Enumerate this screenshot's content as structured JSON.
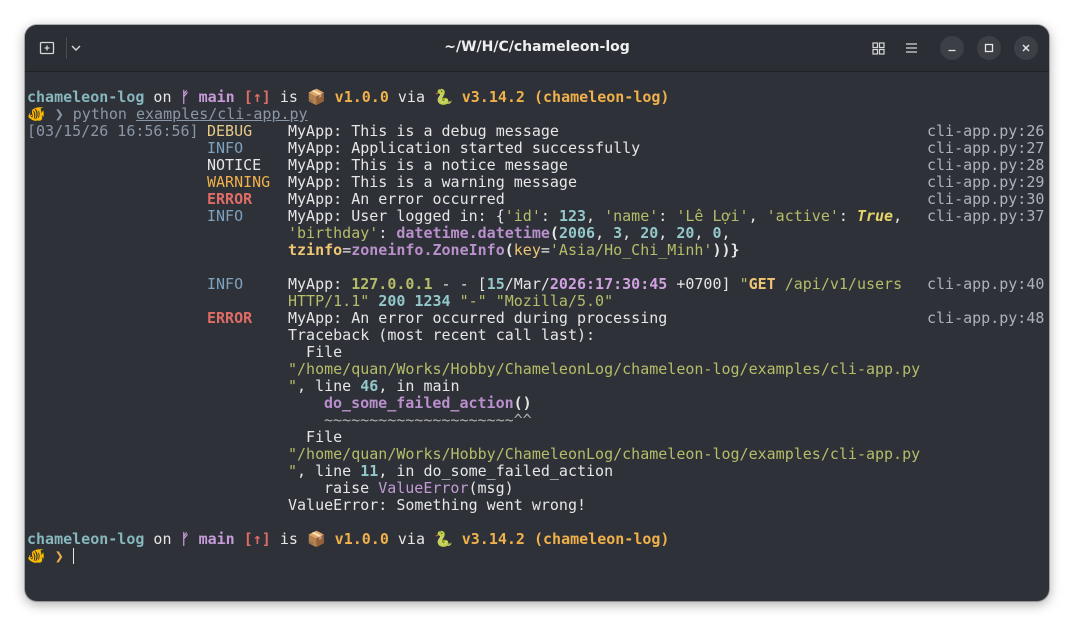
{
  "window": {
    "title": "~/W/H/C/chameleon-log"
  },
  "prompt": {
    "dir": "chameleon-log",
    "on": " on ",
    "branch_icon": "ᚠ",
    "branch": " main ",
    "ahead": "[↑]",
    "is": " is ",
    "pkg_icon": "📦",
    "version": " v1.0.0",
    "via": " via ",
    "py_icon": "🐍",
    "py_version": " v3.14.2 (chameleon-log)",
    "char_icon": "🐠",
    "arrow": " ❯ ",
    "cmd": "python ",
    "cmd_arg": "examples/cli-app.py"
  },
  "timestamp": "[03/15/26 16:56:56]",
  "log": [
    {
      "level": "DEBUG",
      "msg": "MyApp: This is a debug message",
      "src": "cli-app.py:26"
    },
    {
      "level": "INFO",
      "msg": "MyApp: Application started successfully",
      "src": "cli-app.py:27"
    },
    {
      "level": "NOTICE",
      "msg": "MyApp: This is a notice message",
      "src": "cli-app.py:28"
    },
    {
      "level": "WARNING",
      "msg": "MyApp: This is a warning message",
      "src": "cli-app.py:29"
    },
    {
      "level": "ERROR",
      "msg": "MyApp: An error occurred",
      "src": "cli-app.py:30"
    },
    {
      "level": "INFO",
      "src": "cli-app.py:37",
      "user": {
        "prefix": "MyApp: User logged in: {",
        "k_id": "'id'",
        "v_id": "123",
        "k_name": "'name'",
        "v_name": "'Lê Lợi'",
        "k_active": "'active'",
        "v_active": "True",
        "k_birthday": "'birthday'",
        "dt": "datetime.datetime",
        "y": "2006",
        "m": "3",
        "d": "20",
        "h": "20",
        "mi": "0",
        "tz": "tzinfo",
        "zi": "zoneinfo.ZoneInfo",
        "key": "key",
        "keyval": "'Asia/Ho_Chi_Minh'"
      }
    },
    {
      "level": "INFO",
      "src": "cli-app.py:40",
      "access": {
        "prefix": "MyApp: ",
        "ip": "127.0.0.1",
        "dash": " - - [",
        "day": "15",
        "mon": "/Mar/",
        "time": "2026:17:30:45",
        "tz": " +0700",
        "method": "GET",
        "path": " /api/v1/users",
        "proto": "HTTP/1.1",
        "status": "200",
        "size": "1234",
        "ref": "\"-\"",
        "ua": "\"Mozilla/5.0\""
      }
    },
    {
      "level": "ERROR",
      "msg": "MyApp: An error occurred during processing",
      "src": "cli-app.py:48"
    }
  ],
  "traceback": {
    "header": "Traceback (most recent call last):",
    "file_kw": "  File",
    "path": "\"/home/quan/Works/Hobby/ChameleonLog/chameleon-log/examples/cli-app.py",
    "frame1": {
      "line_no": "46",
      "func": "main",
      "code": "do_some_failed_action",
      "code_tail": "()",
      "carets": "~~~~~~~~~~~~~~~~~~~~~^^"
    },
    "frame2": {
      "line_no": "11",
      "func": "do_some_failed_action",
      "raise": "raise ",
      "exc": "ValueError",
      "arg": "(msg)"
    },
    "final": "ValueError: Something went wrong!"
  }
}
